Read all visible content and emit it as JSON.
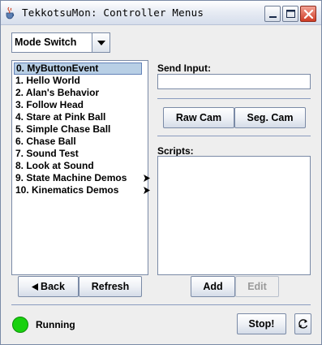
{
  "window": {
    "title": "TekkotsuMon: Controller Menus"
  },
  "mode_combo": {
    "selected": "Mode Switch"
  },
  "menu_list": {
    "items": [
      {
        "label": "0. MyButtonEvent",
        "selected": true,
        "submenu": false
      },
      {
        "label": "1. Hello World",
        "selected": false,
        "submenu": false
      },
      {
        "label": "2. Alan's Behavior",
        "selected": false,
        "submenu": false
      },
      {
        "label": "3. Follow Head",
        "selected": false,
        "submenu": false
      },
      {
        "label": "4. Stare at Pink Ball",
        "selected": false,
        "submenu": false
      },
      {
        "label": "5. Simple Chase Ball",
        "selected": false,
        "submenu": false
      },
      {
        "label": "6. Chase Ball",
        "selected": false,
        "submenu": false
      },
      {
        "label": "7. Sound Test",
        "selected": false,
        "submenu": false
      },
      {
        "label": "8. Look at Sound",
        "selected": false,
        "submenu": false
      },
      {
        "label": "9. State Machine Demos",
        "selected": false,
        "submenu": true
      },
      {
        "label": "10. Kinematics Demos",
        "selected": false,
        "submenu": true
      }
    ]
  },
  "nav": {
    "back_label": "Back",
    "refresh_label": "Refresh"
  },
  "send_input": {
    "label": "Send Input:",
    "value": ""
  },
  "cameras": {
    "raw_label": "Raw Cam",
    "seg_label": "Seg. Cam"
  },
  "scripts": {
    "label": "Scripts:",
    "add_label": "Add",
    "edit_label": "Edit"
  },
  "status": {
    "text": "Running",
    "color": "#19d10f",
    "stop_label": "Stop!"
  },
  "colors": {
    "selection": "#b8cfe5",
    "border": "#7a8aa6",
    "close_button": "#cf3b25"
  },
  "icons": [
    "java-cup-icon",
    "minimize-icon",
    "maximize-icon",
    "close-icon",
    "dropdown-arrow-icon",
    "submenu-arrow-icon",
    "back-arrow-icon",
    "reconnect-icon"
  ]
}
